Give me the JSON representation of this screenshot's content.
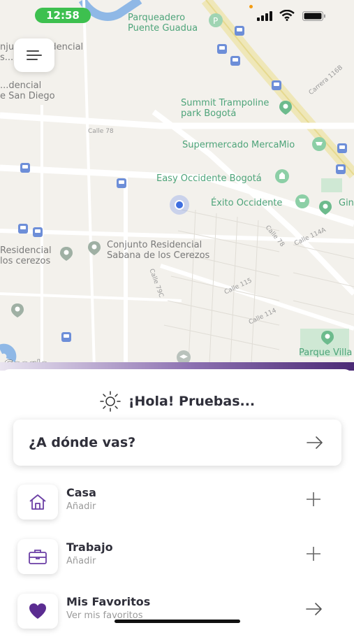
{
  "status_bar": {
    "time": "12:58"
  },
  "map": {
    "pois": [
      {
        "name": "Parqueadero Puente Guadua",
        "line1": "Parqueadero",
        "line2": "Puente Guadua",
        "color": "green"
      },
      {
        "name": "Summit Trampoline park Bogotá",
        "line1": "Summit Trampoline",
        "line2": "park Bogotá",
        "color": "green"
      },
      {
        "name": "Supermercado MercaMio",
        "line1": "Supermercado MercaMio",
        "color": "green"
      },
      {
        "name": "Easy Occidente Bogotá",
        "line1": "Easy Occidente Bogotá",
        "color": "green"
      },
      {
        "name": "Éxito Occidente",
        "line1": "Éxito Occidente",
        "color": "green"
      },
      {
        "name": "Conjunto Residencial Sabana de los Cerezos",
        "line1": "Conjunto Residencial",
        "line2": "Sabana de los Cerezos",
        "color": "gray"
      },
      {
        "name": "Residencial los cerezos",
        "line1": "Residencial",
        "line2": "los cerezos",
        "color": "gray"
      },
      {
        "name": "Conjunto Residencial ...nada",
        "line1": "njunto Residencial",
        "line2": "s...nada",
        "color": "gray"
      },
      {
        "name": "...e San Diego",
        "line1": "...dencial",
        "line2": "e San Diego",
        "color": "gray"
      },
      {
        "name": "Parque Villa",
        "line1": "Parque Villa",
        "color": "green"
      },
      {
        "name": "Gin",
        "line1": "Gin",
        "color": "green"
      }
    ],
    "streets": [
      "Calle 78",
      "Carrera 116B",
      "Calle 78",
      "Calle 114A",
      "Calle 115",
      "Calle 114",
      "Calle 79C"
    ],
    "attribution": "Google"
  },
  "sheet": {
    "greeting": "¡Hola! Pruebas...",
    "destination_prompt": "¿A dónde vas?",
    "items": [
      {
        "title": "Casa",
        "subtitle": "Añadir",
        "icon": "home-icon",
        "action": "plus-icon"
      },
      {
        "title": "Trabajo",
        "subtitle": "Añadir",
        "icon": "briefcase-icon",
        "action": "plus-icon"
      },
      {
        "title": "Mis Favoritos",
        "subtitle": "Ver mis favoritos",
        "icon": "heart-icon",
        "action": "arrow-right-icon"
      }
    ]
  },
  "colors": {
    "accent": "#5b2c91",
    "map_green_text": "#4ea47a",
    "time_pill": "#3dc04f"
  }
}
